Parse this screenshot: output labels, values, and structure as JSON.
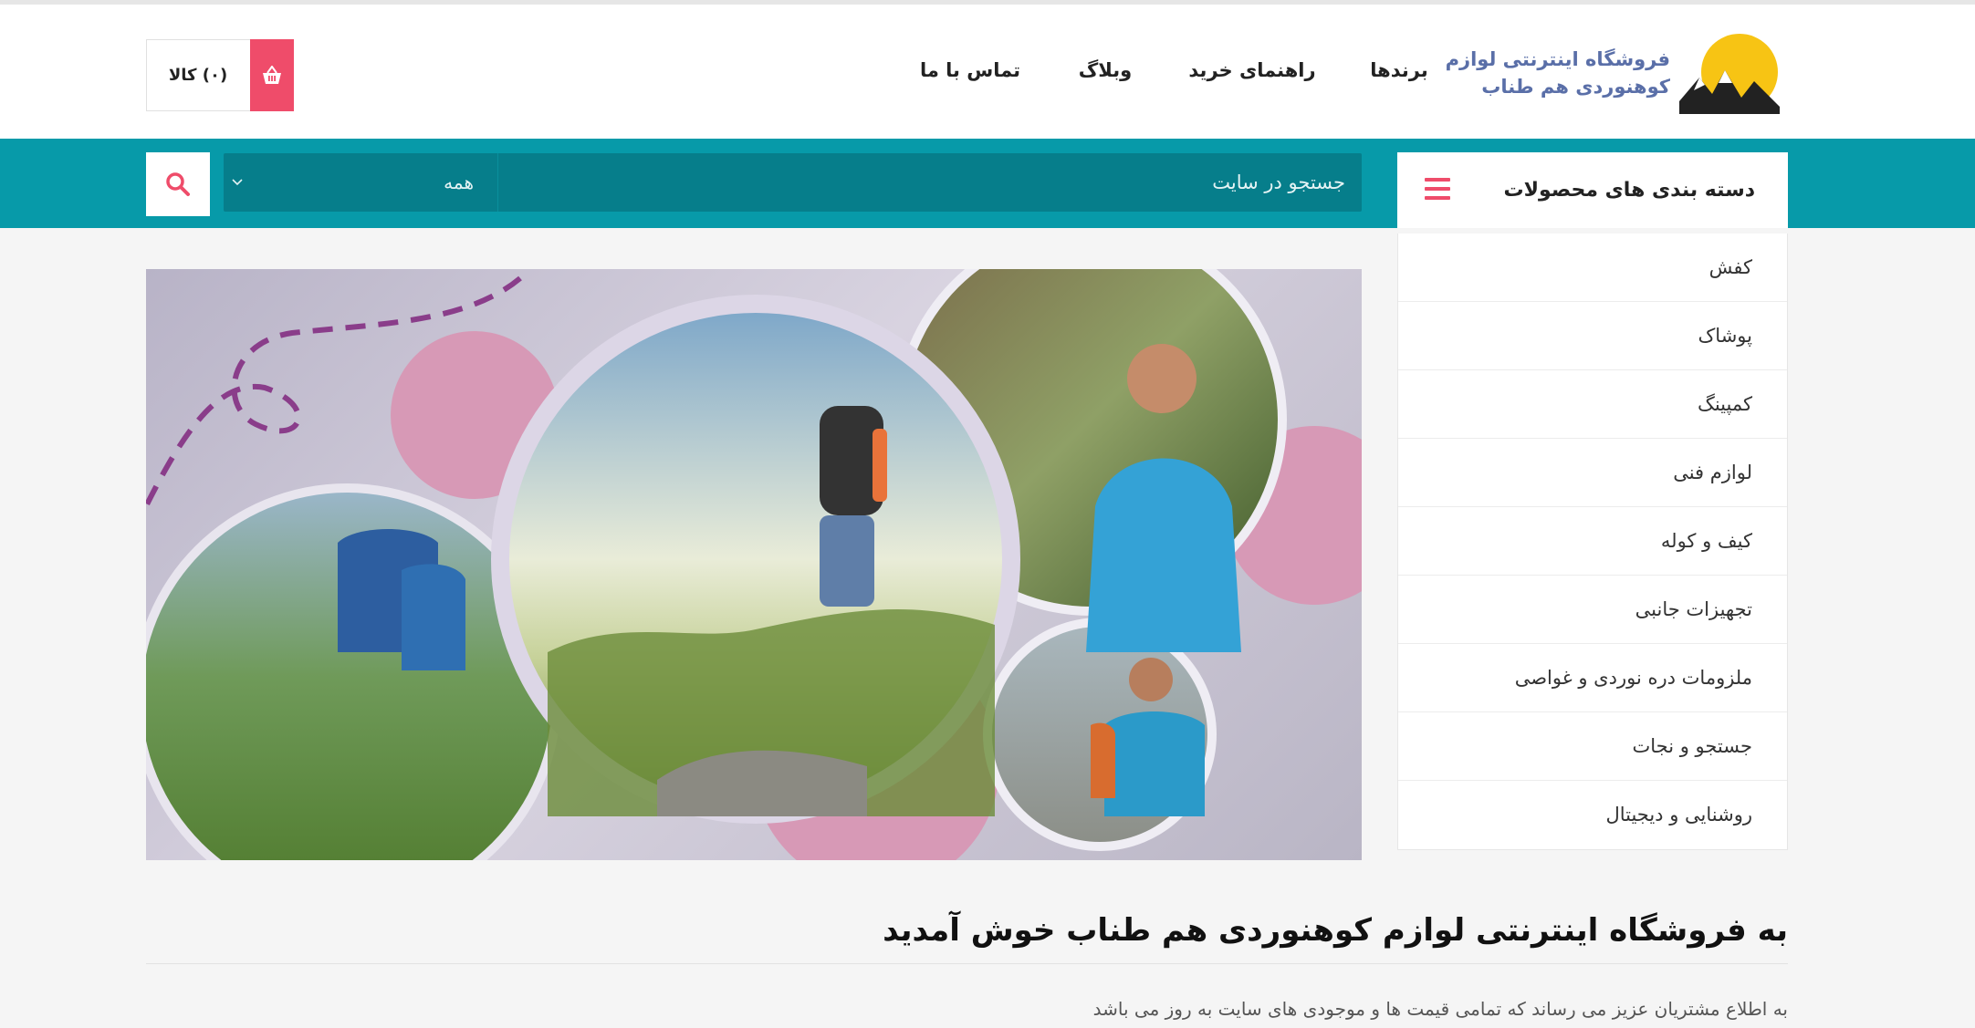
{
  "site": {
    "logo_line1": "فروشگاه اینترنتی لوازم",
    "logo_line2": "کوهنوردی هم طناب"
  },
  "nav": {
    "items": [
      {
        "label": "برندها"
      },
      {
        "label": "راهنمای خرید"
      },
      {
        "label": "وبلاگ"
      },
      {
        "label": "تماس با ما"
      }
    ]
  },
  "cart": {
    "label": "(۰) کالا",
    "icon": "basket-icon"
  },
  "categories": {
    "title": "دسته بندی های محصولات",
    "items": [
      {
        "label": "کفش"
      },
      {
        "label": "پوشاک"
      },
      {
        "label": "کمپینگ"
      },
      {
        "label": "لوازم فنی"
      },
      {
        "label": "کیف و کوله"
      },
      {
        "label": "تجهیزات جانبی"
      },
      {
        "label": "ملزومات دره نوردی و غواصی"
      },
      {
        "label": "جستجو و نجات"
      },
      {
        "label": "روشنایی و دیجیتال"
      }
    ]
  },
  "search": {
    "placeholder": "جستجو در سایت",
    "select_value": "همه"
  },
  "welcome": {
    "title": "به فروشگاه اینترنتی لوازم کوهنوردی هم طناب خوش آمدید",
    "text": "به اطلاع مشتریان عزیز می رساند که تمامی قیمت ها و موجودی های سایت به روز می باشد"
  },
  "colors": {
    "accent": "#ef4c6a",
    "teal": "#079aa9",
    "teal_dark": "#067e8b"
  }
}
